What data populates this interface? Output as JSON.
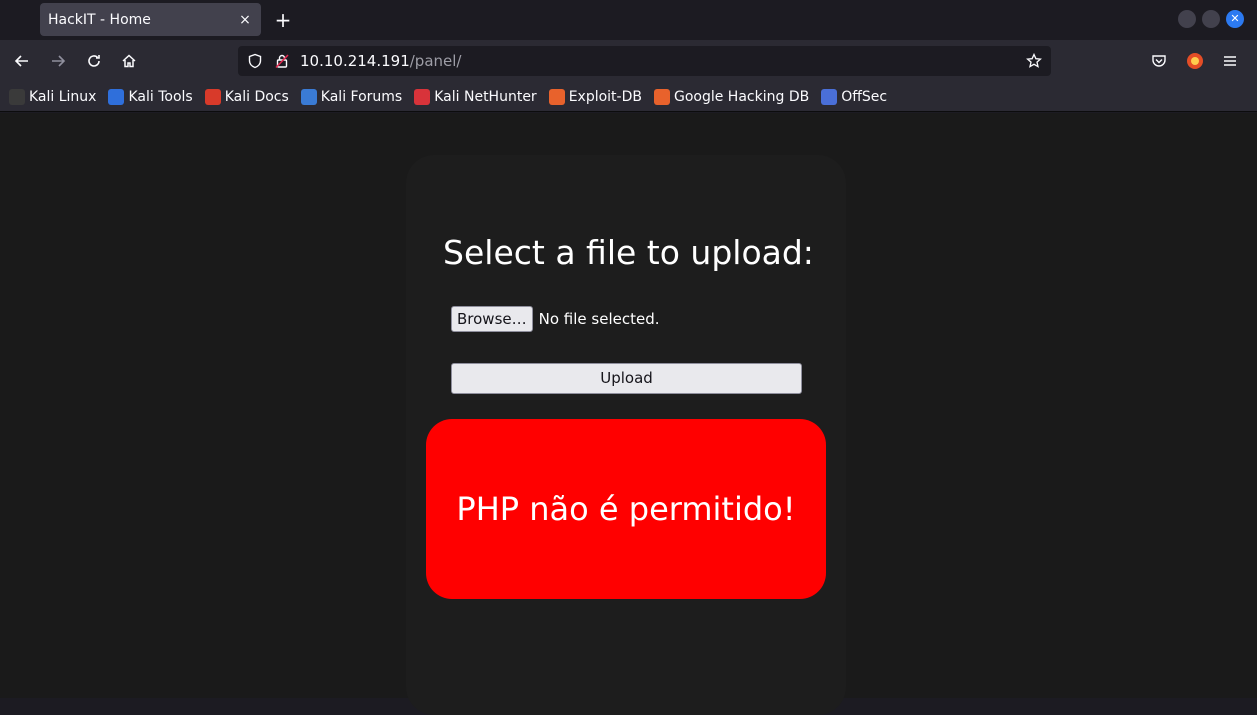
{
  "browser": {
    "tab_title": "HackIT - Home",
    "tab_close": "×",
    "new_tab": "+",
    "url_host": "10.10.214.191",
    "url_path": "/panel/",
    "win_close": "✕"
  },
  "bookmarks": [
    {
      "label": "Kali Linux",
      "icon": "kali-dragon-icon",
      "color": "#3a3a3a"
    },
    {
      "label": "Kali Tools",
      "icon": "kali-tools-icon",
      "color": "#2f6fdb"
    },
    {
      "label": "Kali Docs",
      "icon": "kali-docs-icon",
      "color": "#d83a2a"
    },
    {
      "label": "Kali Forums",
      "icon": "kali-forums-icon",
      "color": "#3a7bd5"
    },
    {
      "label": "Kali NetHunter",
      "icon": "kali-nethunter-icon",
      "color": "#d8333a"
    },
    {
      "label": "Exploit-DB",
      "icon": "exploit-db-icon",
      "color": "#e8622c"
    },
    {
      "label": "Google Hacking DB",
      "icon": "ghdb-icon",
      "color": "#e8622c"
    },
    {
      "label": "OffSec",
      "icon": "offsec-icon",
      "color": "#4a6fd8"
    }
  ],
  "page": {
    "heading": "Select a file to upload:",
    "browse_label": "Browse…",
    "file_status": "No file selected.",
    "upload_label": "Upload",
    "error_message": "PHP não é permitido!"
  },
  "colors": {
    "error_background": "#ff0000",
    "page_background": "#1a1a1a",
    "accent": "#2c7af1"
  }
}
